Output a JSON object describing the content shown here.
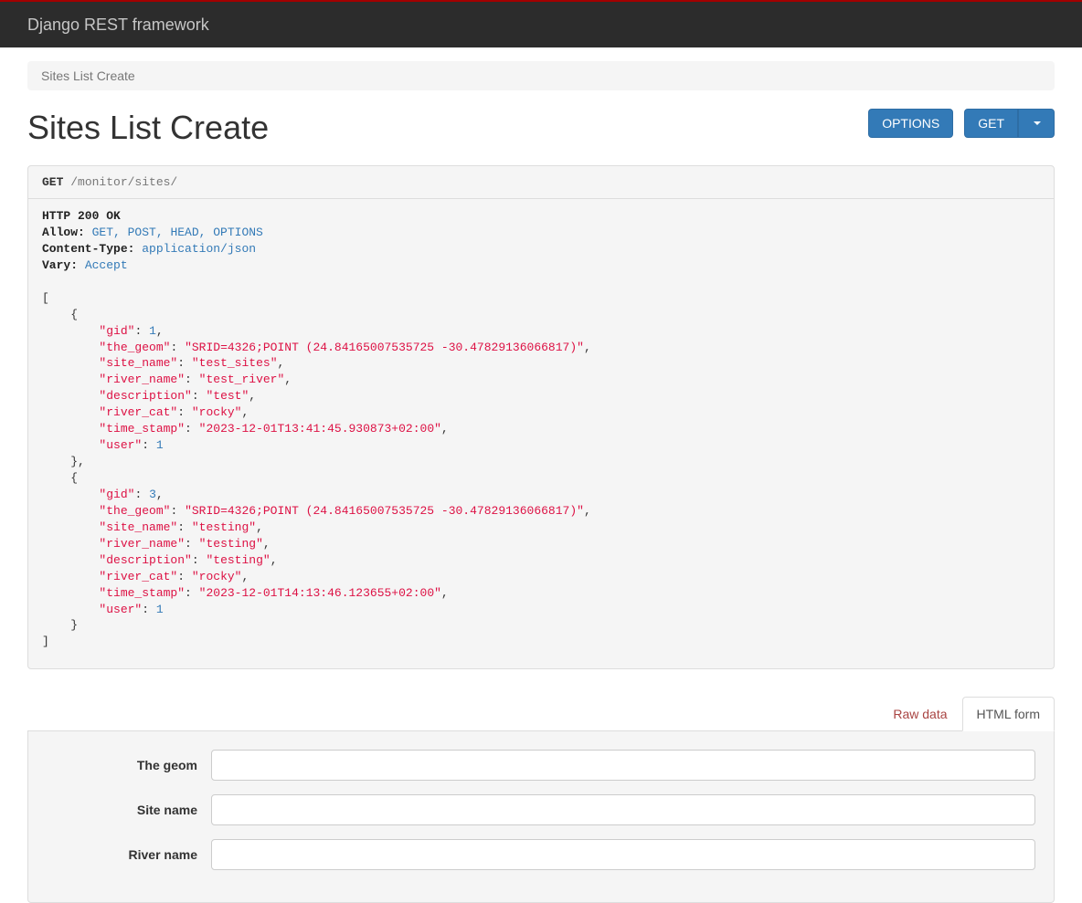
{
  "brand": "Django REST framework",
  "breadcrumb": {
    "label": "Sites List Create"
  },
  "page_title": "Sites List Create",
  "buttons": {
    "options": "OPTIONS",
    "get": "GET"
  },
  "request": {
    "method": "GET",
    "path": "/monitor/sites/"
  },
  "response": {
    "status_line": "HTTP 200 OK",
    "headers": [
      {
        "name": "Allow",
        "value": "GET, POST, HEAD, OPTIONS"
      },
      {
        "name": "Content-Type",
        "value": "application/json"
      },
      {
        "name": "Vary",
        "value": "Accept"
      }
    ],
    "body": [
      {
        "gid": 1,
        "the_geom": "SRID=4326;POINT (24.84165007535725 -30.47829136066817)",
        "site_name": "test_sites",
        "river_name": "test_river",
        "description": "test",
        "river_cat": "rocky",
        "time_stamp": "2023-12-01T13:41:45.930873+02:00",
        "user": 1
      },
      {
        "gid": 3,
        "the_geom": "SRID=4326;POINT (24.84165007535725 -30.47829136066817)",
        "site_name": "testing",
        "river_name": "testing",
        "description": "testing",
        "river_cat": "rocky",
        "time_stamp": "2023-12-01T14:13:46.123655+02:00",
        "user": 1
      }
    ]
  },
  "tabs": {
    "raw": "Raw data",
    "html": "HTML form"
  },
  "form": {
    "fields": [
      {
        "label": "The geom",
        "value": ""
      },
      {
        "label": "Site name",
        "value": ""
      },
      {
        "label": "River name",
        "value": ""
      }
    ]
  }
}
